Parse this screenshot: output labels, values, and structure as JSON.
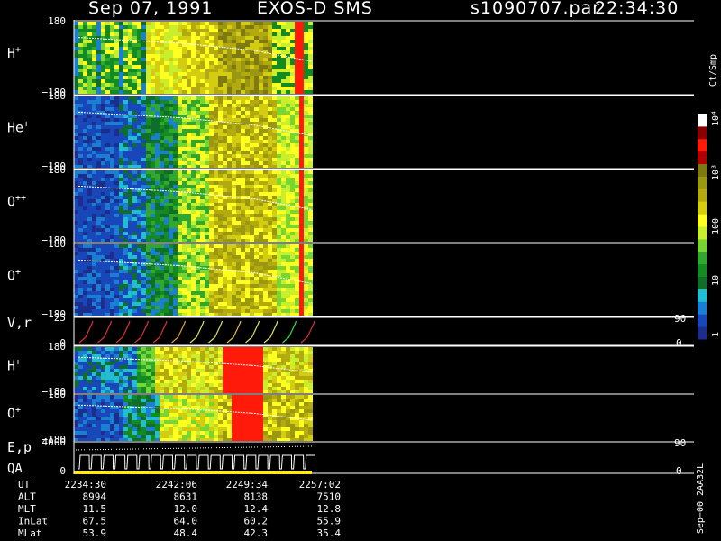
{
  "header": {
    "date": "Sep 07, 1991",
    "instrument": "EXOS-D SMS",
    "file": "s1090707.par",
    "time": "22:34:30"
  },
  "colorbar": {
    "unit_label": "Ct/Smp",
    "tick_labels": [
      "1",
      "10",
      "100",
      "10³",
      "10⁴"
    ],
    "colors": [
      "#1d2d8c",
      "#1747b9",
      "#1a7ed3",
      "#20bfd0",
      "#0f6e2a",
      "#138a22",
      "#30a830",
      "#77d632",
      "#c7ef2b",
      "#ffff20",
      "#d4cc10",
      "#b3aa10",
      "#9a9810",
      "#7f7a10",
      "#b00000",
      "#ff1a0a",
      "#8a0000",
      "#ffffff"
    ]
  },
  "panels": [
    {
      "id": "h-plus",
      "label": "H",
      "sup": "+",
      "ymax": "180",
      "ymin": "−180",
      "right_top": "",
      "right_bottom": ""
    },
    {
      "id": "he-plus",
      "label": "He",
      "sup": "+",
      "ymax": "180",
      "ymin": "−180",
      "right_top": "",
      "right_bottom": ""
    },
    {
      "id": "o-plusplus",
      "label": "O",
      "sup": "++",
      "ymax": "180",
      "ymin": "−180",
      "right_top": "",
      "right_bottom": ""
    },
    {
      "id": "o-plus",
      "label": "O",
      "sup": "+",
      "ymax": "180",
      "ymin": "−180",
      "right_top": "",
      "right_bottom": ""
    },
    {
      "id": "v-r",
      "label": "V,r",
      "sup": "",
      "ymax": "25",
      "ymin": "0",
      "right_top": "90",
      "right_bottom": "0"
    },
    {
      "id": "h-plus-2",
      "label": "H",
      "sup": "+",
      "ymax": "180",
      "ymin": "−180",
      "right_top": "",
      "right_bottom": ""
    },
    {
      "id": "o-plus-2",
      "label": "O",
      "sup": "+",
      "ymax": "180",
      "ymin": "−180",
      "right_top": "",
      "right_bottom": ""
    },
    {
      "id": "e-p",
      "label": "E,p",
      "sup": "",
      "ymax": "4000",
      "ymin": "0",
      "right_top": "90",
      "right_bottom": "0"
    }
  ],
  "qa_label": "QA",
  "orbit_table": {
    "rows": [
      {
        "name": "UT",
        "values": [
          "2234:30",
          "2242:06",
          "2249:34",
          "2257:02"
        ]
      },
      {
        "name": "ALT",
        "values": [
          "8994",
          "8631",
          "8138",
          "7510"
        ]
      },
      {
        "name": "MLT",
        "values": [
          "11.5",
          "12.0",
          "12.4",
          "12.8"
        ]
      },
      {
        "name": "InLat",
        "values": [
          "67.5",
          "64.0",
          "60.2",
          "55.9"
        ]
      },
      {
        "name": "MLat",
        "values": [
          "53.9",
          "48.4",
          "42.3",
          "35.4"
        ]
      }
    ]
  },
  "footer_code": "Sep−00  2AA32L",
  "chart_data": {
    "type": "heatmap",
    "title": "Sep 07, 1991   EXOS-D SMS",
    "x_axis": {
      "label": "UT",
      "ticks": [
        "2234:30",
        "2242:06",
        "2249:34",
        "2257:02"
      ],
      "data_coverage": "2234:30 to about 2258:30"
    },
    "color_scale": {
      "unit": "Ct/Smp",
      "scale": "log",
      "range": [
        1,
        10000
      ]
    },
    "series": [
      {
        "name": "H+",
        "y_range": [
          -180,
          180
        ],
        "trend": "green/yellow, dark spin modulation stripes, red streak at end"
      },
      {
        "name": "He+",
        "y_range": [
          -180,
          180
        ],
        "trend": "blue early, rising to green/yellow"
      },
      {
        "name": "O++",
        "y_range": [
          -180,
          180
        ],
        "trend": "blue early, rising to green/yellow"
      },
      {
        "name": "O+",
        "y_range": [
          -180,
          180
        ],
        "trend": "blue early, rising to green/yellow"
      },
      {
        "name": "V,r",
        "y_range": [
          0,
          25
        ],
        "right_range": [
          0,
          90
        ],
        "trend": "sawtooth traces per spin"
      },
      {
        "name": "H+",
        "y_range": [
          -180,
          180
        ],
        "trend": "cyan/green early, red band near 2252"
      },
      {
        "name": "O+",
        "y_range": [
          -180,
          180
        ],
        "trend": "blue early, red band near 2252"
      },
      {
        "name": "E,p",
        "y_range": [
          0,
          4000
        ],
        "right_range": [
          0,
          90
        ],
        "trend": "step pattern"
      }
    ]
  }
}
